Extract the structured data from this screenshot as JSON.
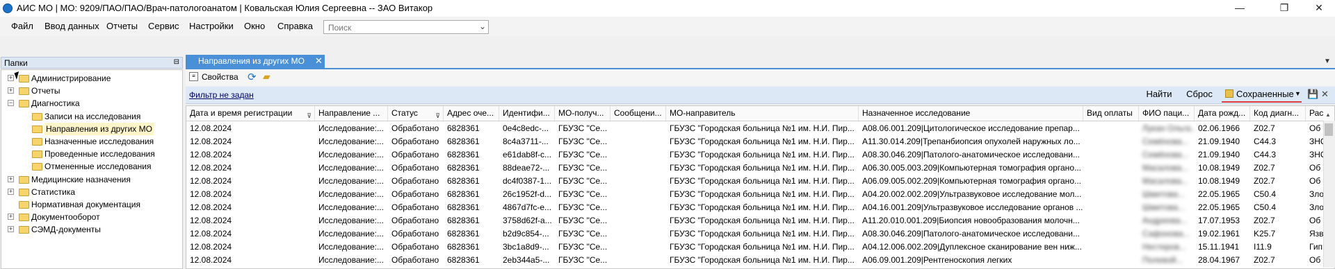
{
  "window": {
    "title": "АИС МО | МО: 9209/ПАО/ПАО/Врач-патологоанатом | Ковальская Юлия Сергеевна -- ЗАО Витакор",
    "controls": {
      "minimize": "—",
      "maximize": "❐",
      "close": "✕"
    }
  },
  "menu": {
    "items": [
      "Файл",
      "Ввод данных",
      "Отчеты",
      "Сервис",
      "Настройки",
      "Окно",
      "Справка"
    ],
    "search_placeholder": "Поиск"
  },
  "left_panel": {
    "title": "Папки",
    "pin": "⊟",
    "tree": [
      {
        "label": "Администрирование",
        "level": 0,
        "expander": "+",
        "selected": false
      },
      {
        "label": "Отчеты",
        "level": 0,
        "expander": "+",
        "selected": false
      },
      {
        "label": "Диагностика",
        "level": 0,
        "expander": "−",
        "selected": false
      },
      {
        "label": "Записи на исследования",
        "level": 1,
        "expander": "",
        "selected": false
      },
      {
        "label": "Направления из других МО",
        "level": 1,
        "expander": "",
        "selected": true
      },
      {
        "label": "Назначенные исследования",
        "level": 1,
        "expander": "",
        "selected": false
      },
      {
        "label": "Проведенные исследования",
        "level": 1,
        "expander": "",
        "selected": false
      },
      {
        "label": "Отмененные исследования",
        "level": 1,
        "expander": "",
        "selected": false
      },
      {
        "label": "Медицинские назначения",
        "level": 0,
        "expander": "+",
        "selected": false
      },
      {
        "label": "Статистика",
        "level": 0,
        "expander": "+",
        "selected": false
      },
      {
        "label": "Нормативная документация",
        "level": 0,
        "expander": "",
        "selected": false
      },
      {
        "label": "Документооборот",
        "level": 0,
        "expander": "+",
        "selected": false
      },
      {
        "label": "СЭМД-документы",
        "level": 0,
        "expander": "+",
        "selected": false
      }
    ]
  },
  "tab": {
    "label": "Направления из других МО",
    "close": "✕"
  },
  "toolbar": {
    "properties_label": "Свойства"
  },
  "filter": {
    "link": "Фильтр не задан",
    "find": "Найти",
    "reset": "Сброс",
    "saved": "Сохраненные"
  },
  "grid": {
    "columns": [
      "Дата и время регистрации",
      "Направление ...",
      "Статус",
      "Адрес оче...",
      "Идентифи...",
      "МО-получ...",
      "Сообщени...",
      "МО-направитель",
      "Назначенное исследование",
      "Вид оплаты",
      "ФИО паци...",
      "Дата рожд...",
      "Код диагн...",
      "Рас"
    ],
    "rows": [
      [
        "12.08.2024",
        "Исследование:...",
        "Обработано",
        "6828361",
        "0e4c8edc-...",
        "ГБУЗС \"Се...",
        "",
        "ГБУЗС \"Городская больница №1 им. Н.И. Пир...",
        "A08.06.001.209|Цитологическое исследование препар...",
        "",
        "Лукан Ольга...",
        "02.06.1966",
        "Z02.7",
        "Об"
      ],
      [
        "12.08.2024",
        "Исследование:...",
        "Обработано",
        "6828361",
        "8c4a3711-...",
        "ГБУЗС \"Се...",
        "",
        "ГБУЗС \"Городская больница №1 им. Н.И. Пир...",
        "A11.30.014.209|Трепанбиопсия опухолей наружных ло...",
        "",
        "Семёнова...",
        "21.09.1940",
        "C44.3",
        "ЗНО"
      ],
      [
        "12.08.2024",
        "Исследование:...",
        "Обработано",
        "6828361",
        "e61dab8f-c...",
        "ГБУЗС \"Се...",
        "",
        "ГБУЗС \"Городская больница №1 им. Н.И. Пир...",
        "A08.30.046.209|Патолого-анатомическое исследовани...",
        "",
        "Семёнова...",
        "21.09.1940",
        "C44.3",
        "ЗНО"
      ],
      [
        "12.08.2024",
        "Исследование:...",
        "Обработано",
        "6828361",
        "88deae72-...",
        "ГБУЗС \"Се...",
        "",
        "ГБУЗС \"Городская больница №1 им. Н.И. Пир...",
        "A06.30.005.003.209|Компьютерная томография органо...",
        "",
        "Масалова...",
        "10.08.1949",
        "Z02.7",
        "Об"
      ],
      [
        "12.08.2024",
        "Исследование:...",
        "Обработано",
        "6828361",
        "dc4f0387-1...",
        "ГБУЗС \"Се...",
        "",
        "ГБУЗС \"Городская больница №1 им. Н.И. Пир...",
        "A06.09.005.002.209|Компьютерная томография органо...",
        "",
        "Масалова...",
        "10.08.1949",
        "Z02.7",
        "Об"
      ],
      [
        "12.08.2024",
        "Исследование:...",
        "Обработано",
        "6828361",
        "26c1952f-d...",
        "ГБУЗС \"Се...",
        "",
        "ГБУЗС \"Городская больница №1 им. Н.И. Пир...",
        "A04.20.002.002.209|Ультразвуковое исследование мол...",
        "",
        "Шмитова...",
        "22.05.1965",
        "C50.4",
        "Зло"
      ],
      [
        "12.08.2024",
        "Исследование:...",
        "Обработано",
        "6828361",
        "4867d7fc-e...",
        "ГБУЗС \"Се...",
        "",
        "ГБУЗС \"Городская больница №1 им. Н.И. Пир...",
        "A04.16.001.209|Ультразвуковое исследование органов ...",
        "",
        "Шмитова...",
        "22.05.1965",
        "C50.4",
        "Зло"
      ],
      [
        "12.08.2024",
        "Исследование:...",
        "Обработано",
        "6828361",
        "3758d62f-a...",
        "ГБУЗС \"Се...",
        "",
        "ГБУЗС \"Городская больница №1 им. Н.И. Пир...",
        "A11.20.010.001.209|Биопсия новообразования молочн...",
        "",
        "Андреева...",
        "17.07.1953",
        "Z02.7",
        "Об"
      ],
      [
        "12.08.2024",
        "Исследование:...",
        "Обработано",
        "6828361",
        "b2d9c854-...",
        "ГБУЗС \"Се...",
        "",
        "ГБУЗС \"Городская больница №1 им. Н.И. Пир...",
        "A08.30.046.209|Патолого-анатомическое исследовани...",
        "",
        "Сафонова...",
        "19.02.1961",
        "K25.7",
        "Язв"
      ],
      [
        "12.08.2024",
        "Исследование:...",
        "Обработано",
        "6828361",
        "3bc1a8d9-...",
        "ГБУЗС \"Се...",
        "",
        "ГБУЗС \"Городская больница №1 им. Н.И. Пир...",
        "A04.12.006.002.209|Дуплексное сканирование вен ниж...",
        "",
        "Нестеров...",
        "15.11.1941",
        "I11.9",
        "Гип"
      ],
      [
        "12.08.2024",
        "Исследование:...",
        "Обработано",
        "6828361",
        "2eb344a5-...",
        "ГБУЗС \"Се...",
        "",
        "ГБУЗС \"Городская больница №1 им. Н.И. Пир...",
        "A06.09.001.209|Рентгеноскопия легких",
        "",
        "Полевой...",
        "28.04.1967",
        "Z02.7",
        "Об"
      ]
    ]
  }
}
